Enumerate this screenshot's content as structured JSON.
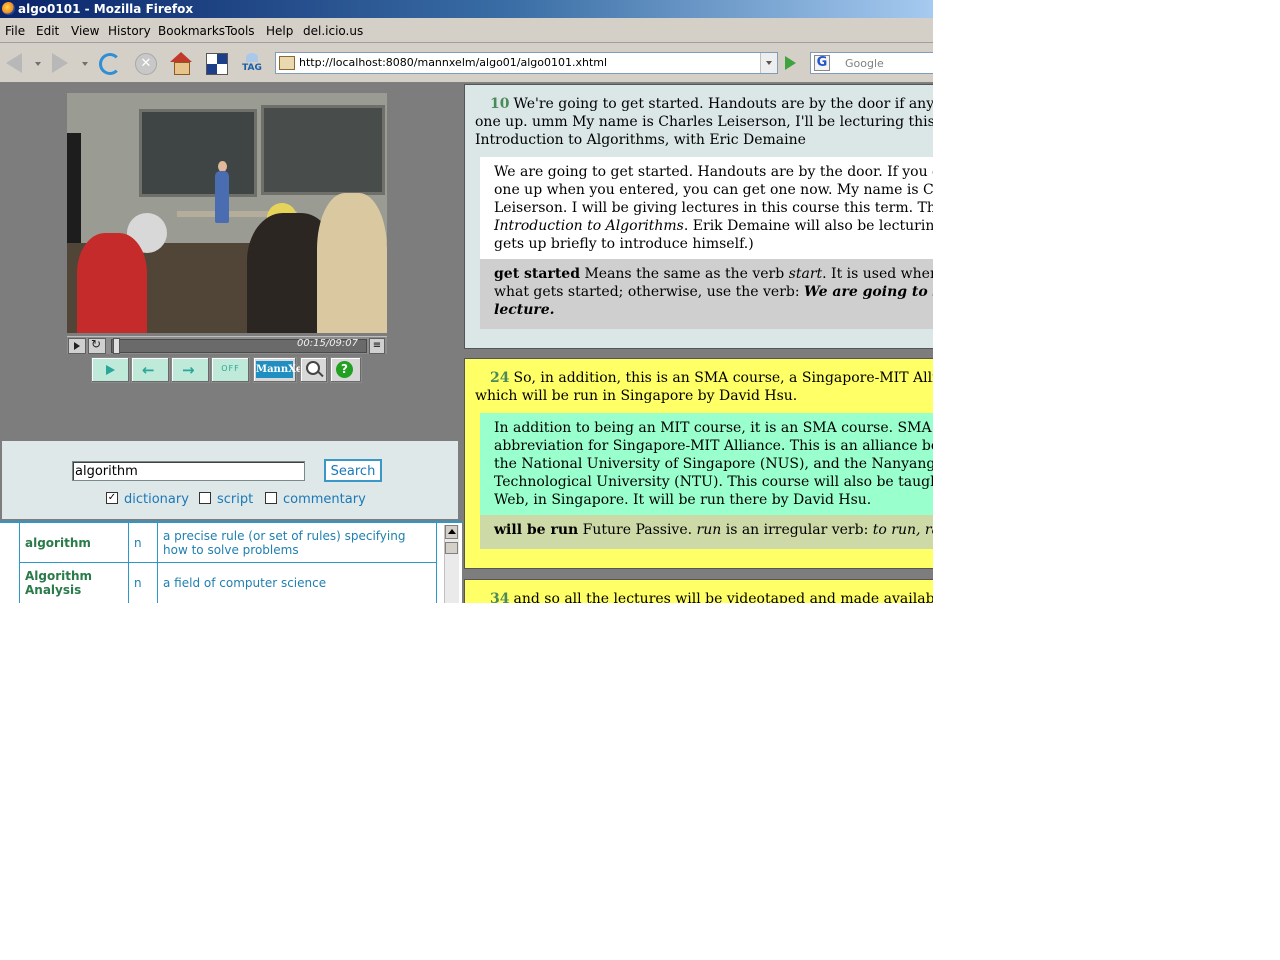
{
  "window": {
    "title": "algo0101 - Mozilla Firefox"
  },
  "menu": [
    "File",
    "Edit",
    "View",
    "History",
    "Bookmarks",
    "Tools",
    "Help",
    "del.icio.us"
  ],
  "toolbar": {
    "url": "http://localhost:8080/mannxelm/algo01/algo0101.xhtml",
    "search_engine_placeholder": "Google",
    "tag_label": "TAG"
  },
  "video": {
    "time": "00:15/09:07"
  },
  "player_buttons": {
    "off_label": "OFF",
    "logo_label": "MannXelm"
  },
  "search": {
    "query": "algorithm",
    "button": "Search",
    "options": [
      {
        "label": "dictionary",
        "checked": true
      },
      {
        "label": "script",
        "checked": false
      },
      {
        "label": "commentary",
        "checked": false
      }
    ]
  },
  "results": [
    {
      "word": "algorithm",
      "pos": "n",
      "definition_line1": "a precise rule (or set of rules) specifying",
      "definition_line2": "how to solve problems"
    },
    {
      "word_line1": "Algorithm",
      "word_line2": "Analysis",
      "pos": "n",
      "definition": "a field of computer science"
    }
  ],
  "transcript": {
    "entry1": {
      "num": "10",
      "line1": "We're going to get started. Handouts are by the door if anybody did",
      "line2": "one up. umm My name is Charles Leiserson, I'll be lecturing this course th",
      "line3": "Introduction to Algorithms, with Eric Demaine",
      "sub_line1": "We are going to get started. Handouts are by the door. If you didn't pi",
      "sub_line2": "one up when you entered, you can get one now. My name is Charles",
      "sub_line3": "Leiserson. I will be giving lectures in this course this term. The course",
      "sub_line4_italic": "Introduction to Algorithms",
      "sub_line4_rest": ". Erik Demaine will also be lecturing. (Erik De",
      "sub_line5": "gets up briefly to introduce himself.)",
      "note_term": "get started",
      "note_line1_a": " Means the same as the verb ",
      "note_line1_it": "start",
      "note_line1_b": ". It is used when you don",
      "note_line2_a": "what gets started; otherwise, use the verb: ",
      "note_line2_bi": "We are going to start the",
      "note_line3_bi": "lecture."
    },
    "entry2": {
      "num": "24",
      "line1": "So, in addition, this is an SMA course, a Singapore-MIT Alliance co",
      "line2": "which will be run in Singapore by David Hsu.",
      "sub_line1": "In addition to being an MIT course, it is an SMA course. SMA is an",
      "sub_line2": "abbreviation for Singapore-MIT Alliance. This is an alliance between M",
      "sub_line3": "the National University of Singapore (NUS), and the Nanyang",
      "sub_line4": "Technological University (NTU). This course will also be taught, over",
      "sub_line5": "Web, in Singapore. It will be run there by David Hsu.",
      "note_term": "will be run",
      "note_a": " Future Passive. ",
      "note_it1": "run",
      "note_b": " is an irregular verb: ",
      "note_it2": "to run, ran, run."
    },
    "entry3": {
      "num": "34",
      "line1": "and so all the lectures will be videotaped and made available on the"
    }
  }
}
